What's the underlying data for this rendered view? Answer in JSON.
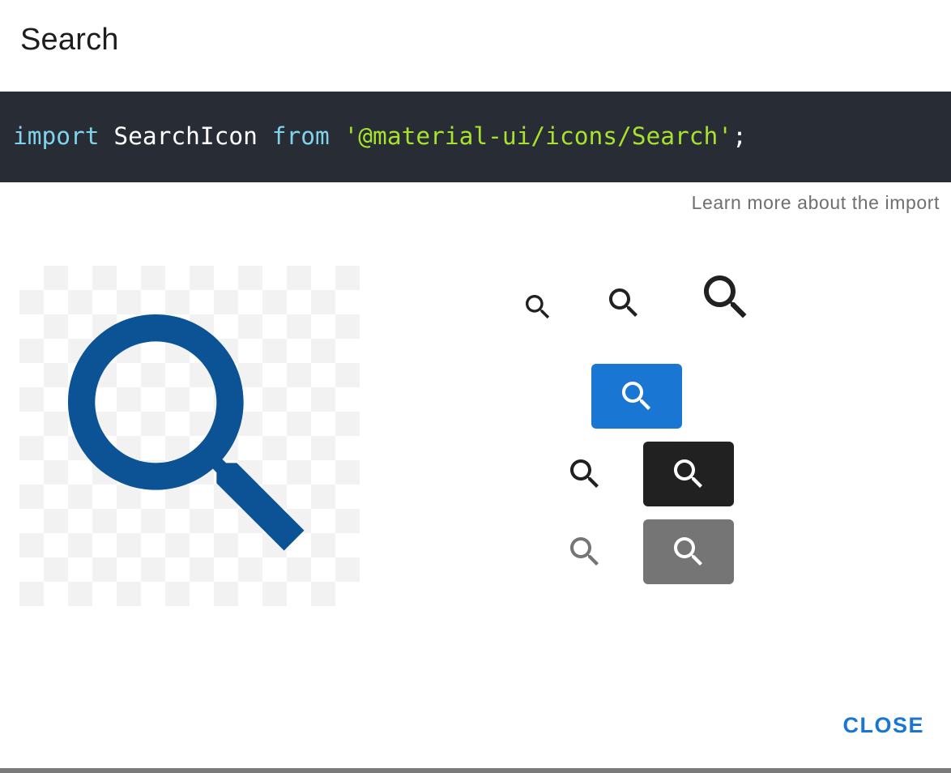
{
  "dialog": {
    "title": "Search",
    "code": {
      "keyword_import": "import",
      "identifier": " SearchIcon ",
      "keyword_from": "from",
      "string": "'@material-ui/icons/Search'",
      "terminator": ";"
    },
    "learn_more": "Learn more about the import",
    "close_label": "CLOSE"
  },
  "icons": {
    "name": "search-icon",
    "preview_color": "#0b5394",
    "dark_color": "#212121",
    "primary_button_color": "#1976d2",
    "dark_button_color": "#212121",
    "disabled_button_color": "#757575",
    "disabled_icon_color": "#757575"
  }
}
